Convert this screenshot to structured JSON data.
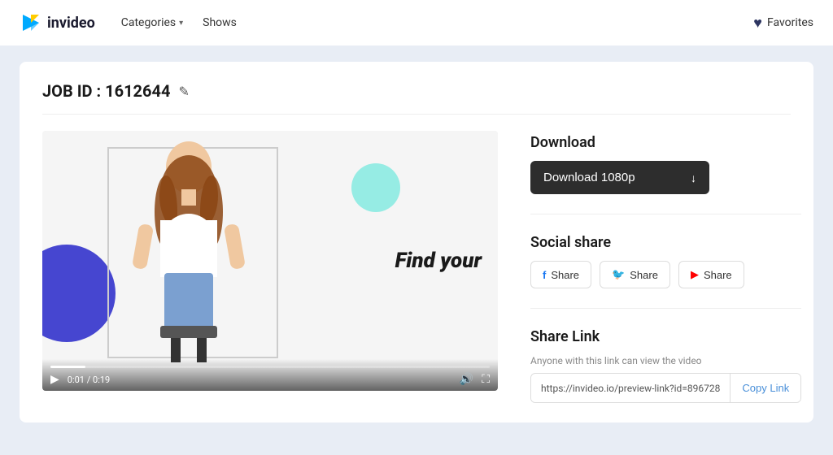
{
  "navbar": {
    "logo_text": "invideo",
    "nav_items": [
      {
        "label": "Categories",
        "has_chevron": true
      },
      {
        "label": "Shows",
        "has_chevron": false
      }
    ],
    "favorites_label": "Favorites"
  },
  "content": {
    "job_id_label": "JOB ID : 1612644",
    "video": {
      "text_overlay": "Find your",
      "current_time": "0:01",
      "total_time": "0:19",
      "progress_percent": 8
    },
    "download": {
      "section_title": "Download",
      "button_label": "Download 1080p"
    },
    "social_share": {
      "section_title": "Social share",
      "buttons": [
        {
          "icon": "fb",
          "label": "Share"
        },
        {
          "icon": "tw",
          "label": "Share"
        },
        {
          "icon": "yt",
          "label": "Share"
        }
      ]
    },
    "share_link": {
      "section_title": "Share Link",
      "description": "Anyone with this link can view the video",
      "url": "https://invideo.io/preview-link?id=896728",
      "copy_label": "Copy Link"
    }
  }
}
